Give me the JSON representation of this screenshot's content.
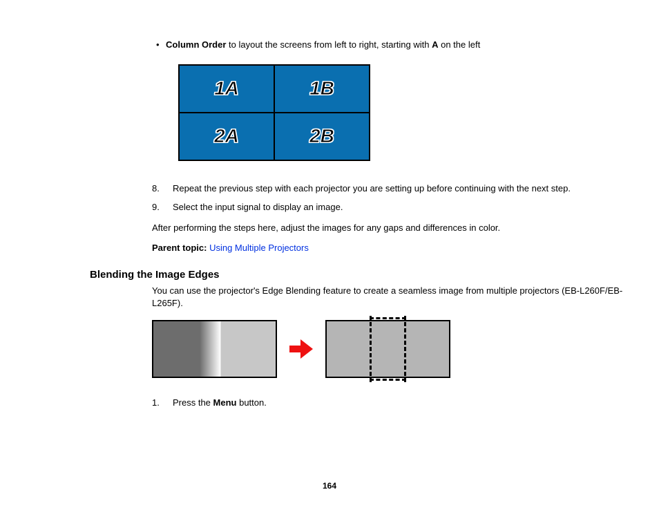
{
  "bullet": {
    "strong1": "Column Order",
    "mid": " to layout the screens from left to right, starting with ",
    "strong2": "A",
    "tail": " on the left"
  },
  "grid": {
    "c11": "1A",
    "c12": "1B",
    "c21": "2A",
    "c22": "2B"
  },
  "step8_num": "8.",
  "step8": "Repeat the previous step with each projector you are setting up before continuing with the next step.",
  "step9_num": "9.",
  "step9": "Select the input signal to display an image.",
  "afterPara": "After performing the steps here, adjust the images for any gaps and differences in color.",
  "parentTopicLabel": "Parent topic: ",
  "parentTopicLink": "Using Multiple Projectors",
  "heading": "Blending the Image Edges",
  "intro": "You can use the projector's Edge Blending feature to create a seamless image from multiple projectors (EB-L260F/EB-L265F).",
  "step1_num": "1.",
  "step1_pre": "Press the ",
  "step1_strong": "Menu",
  "step1_post": " button.",
  "pageNumber": "164"
}
